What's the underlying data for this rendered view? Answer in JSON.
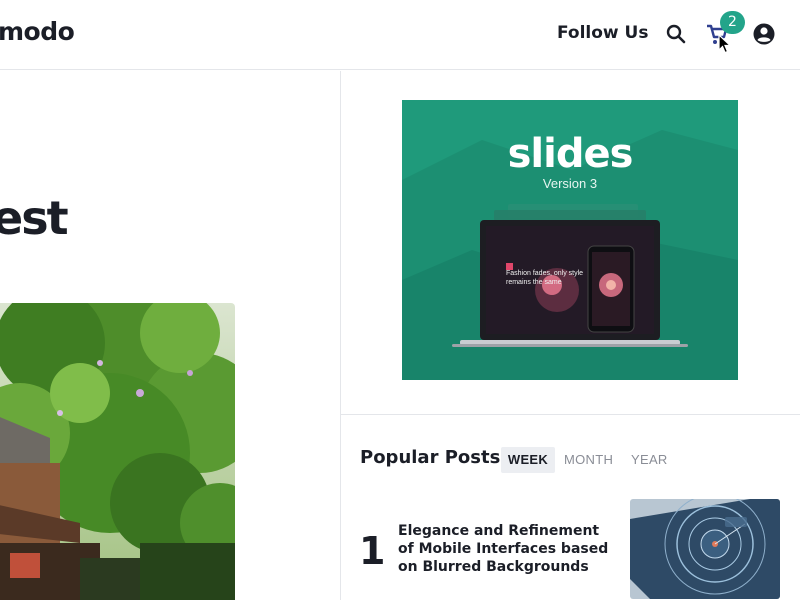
{
  "header": {
    "logo": "modo",
    "follow_label": "Follow Us",
    "search_icon": "search-icon",
    "cart_icon": "cart-icon",
    "cart_count": "2",
    "account_icon": "account-icon",
    "accent_color": "#23a48a"
  },
  "hero": {
    "title_fragment": "est"
  },
  "ad": {
    "brand": "slides",
    "version": "Version 3",
    "tagline": "Fashion fades, only style remains the same",
    "background_color": "#1f9a7b"
  },
  "popular": {
    "title": "Popular Posts",
    "tabs": [
      "WEEK",
      "MONTH",
      "YEAR"
    ],
    "active_tab": "WEEK",
    "posts": [
      {
        "rank": "1",
        "title": "Elegance and Refinement of Mobile Interfaces based on Blurred Backgrounds"
      }
    ]
  }
}
